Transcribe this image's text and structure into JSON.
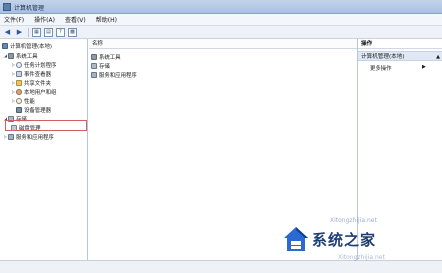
{
  "window": {
    "title": "计算机管理"
  },
  "menubar": {
    "file": "文件(F)",
    "action": "操作(A)",
    "view": "查看(V)",
    "help": "帮助(H)"
  },
  "tree": {
    "root": "计算机管理(本地)",
    "system_tools": "系统工具",
    "task_scheduler": "任务计划程序",
    "event_viewer": "事件查看器",
    "shared_folders": "共享文件夹",
    "local_users": "本地用户和组",
    "performance": "性能",
    "device_manager": "设备管理器",
    "storage": "存储",
    "disk_management": "磁盘管理",
    "services_apps": "服务和应用程序"
  },
  "center": {
    "column_name": "名称",
    "items": [
      "系统工具",
      "存储",
      "服务和应用程序"
    ]
  },
  "actions": {
    "title": "操作",
    "section": "计算机管理(本地)",
    "more": "更多操作"
  },
  "watermark": {
    "brand": "系统之家",
    "url": "Xitongzhijia.net"
  }
}
